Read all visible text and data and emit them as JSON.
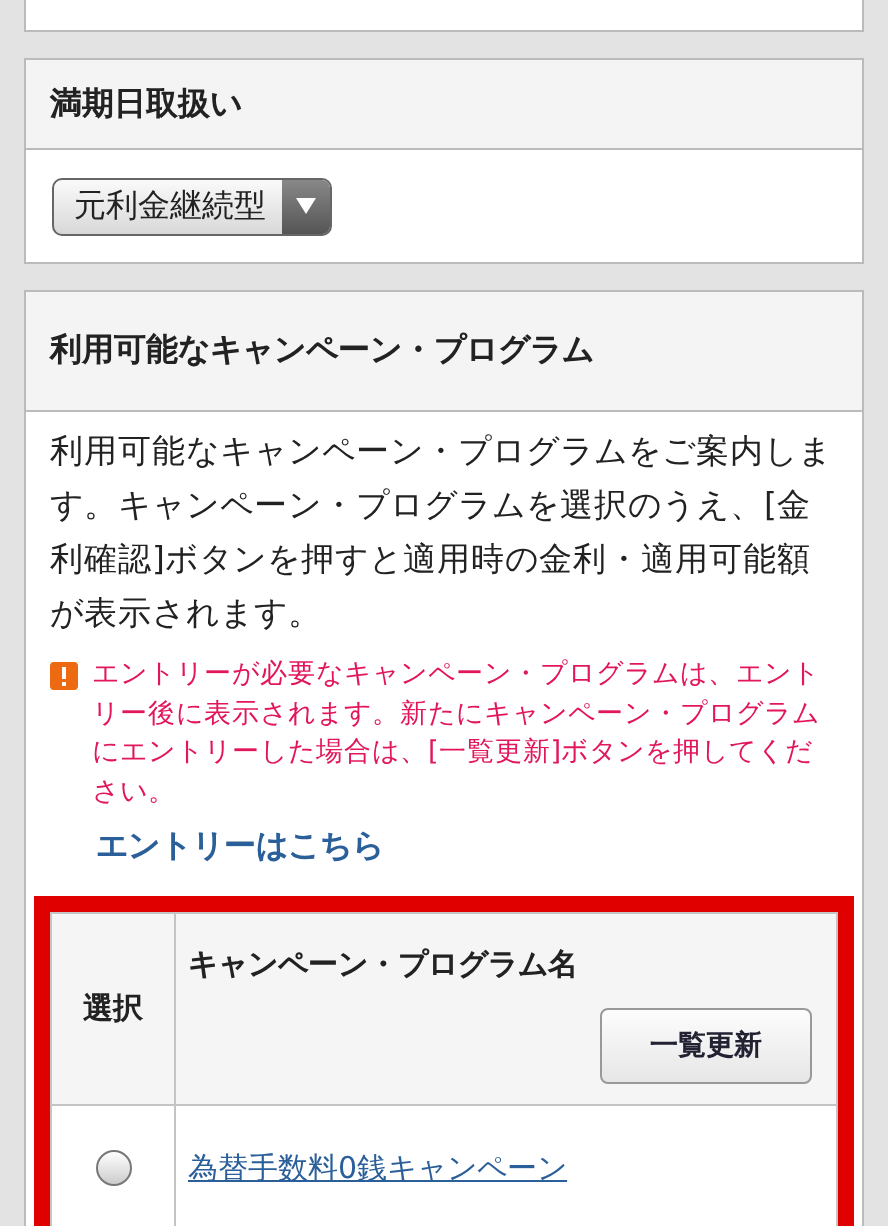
{
  "maturity_section": {
    "title": "満期日取扱い",
    "dropdown": {
      "value": "元利金継続型"
    }
  },
  "campaign_section": {
    "title": "利用可能なキャンペーン・プログラム",
    "description": "利用可能なキャンペーン・プログラムをご案内します。キャンペーン・プログラムを選択のうえ、[金利確認]ボタンを押すと適用時の金利・適用可能額が表示されます。",
    "warning": "エントリーが必要なキャンペーン・プログラムは、エントリー後に表示されます。新たにキャンペーン・プログラムにエントリーした場合は、[一覧更新]ボタンを押してください。",
    "entry_link": "エントリーはこちら",
    "table": {
      "columns": [
        "選択",
        "キャンペーン・プログラム名"
      ],
      "refresh_button": "一覧更新",
      "rows": [
        {
          "name": "為替手数料0銭キャンペーン",
          "selected": false
        }
      ]
    }
  }
}
